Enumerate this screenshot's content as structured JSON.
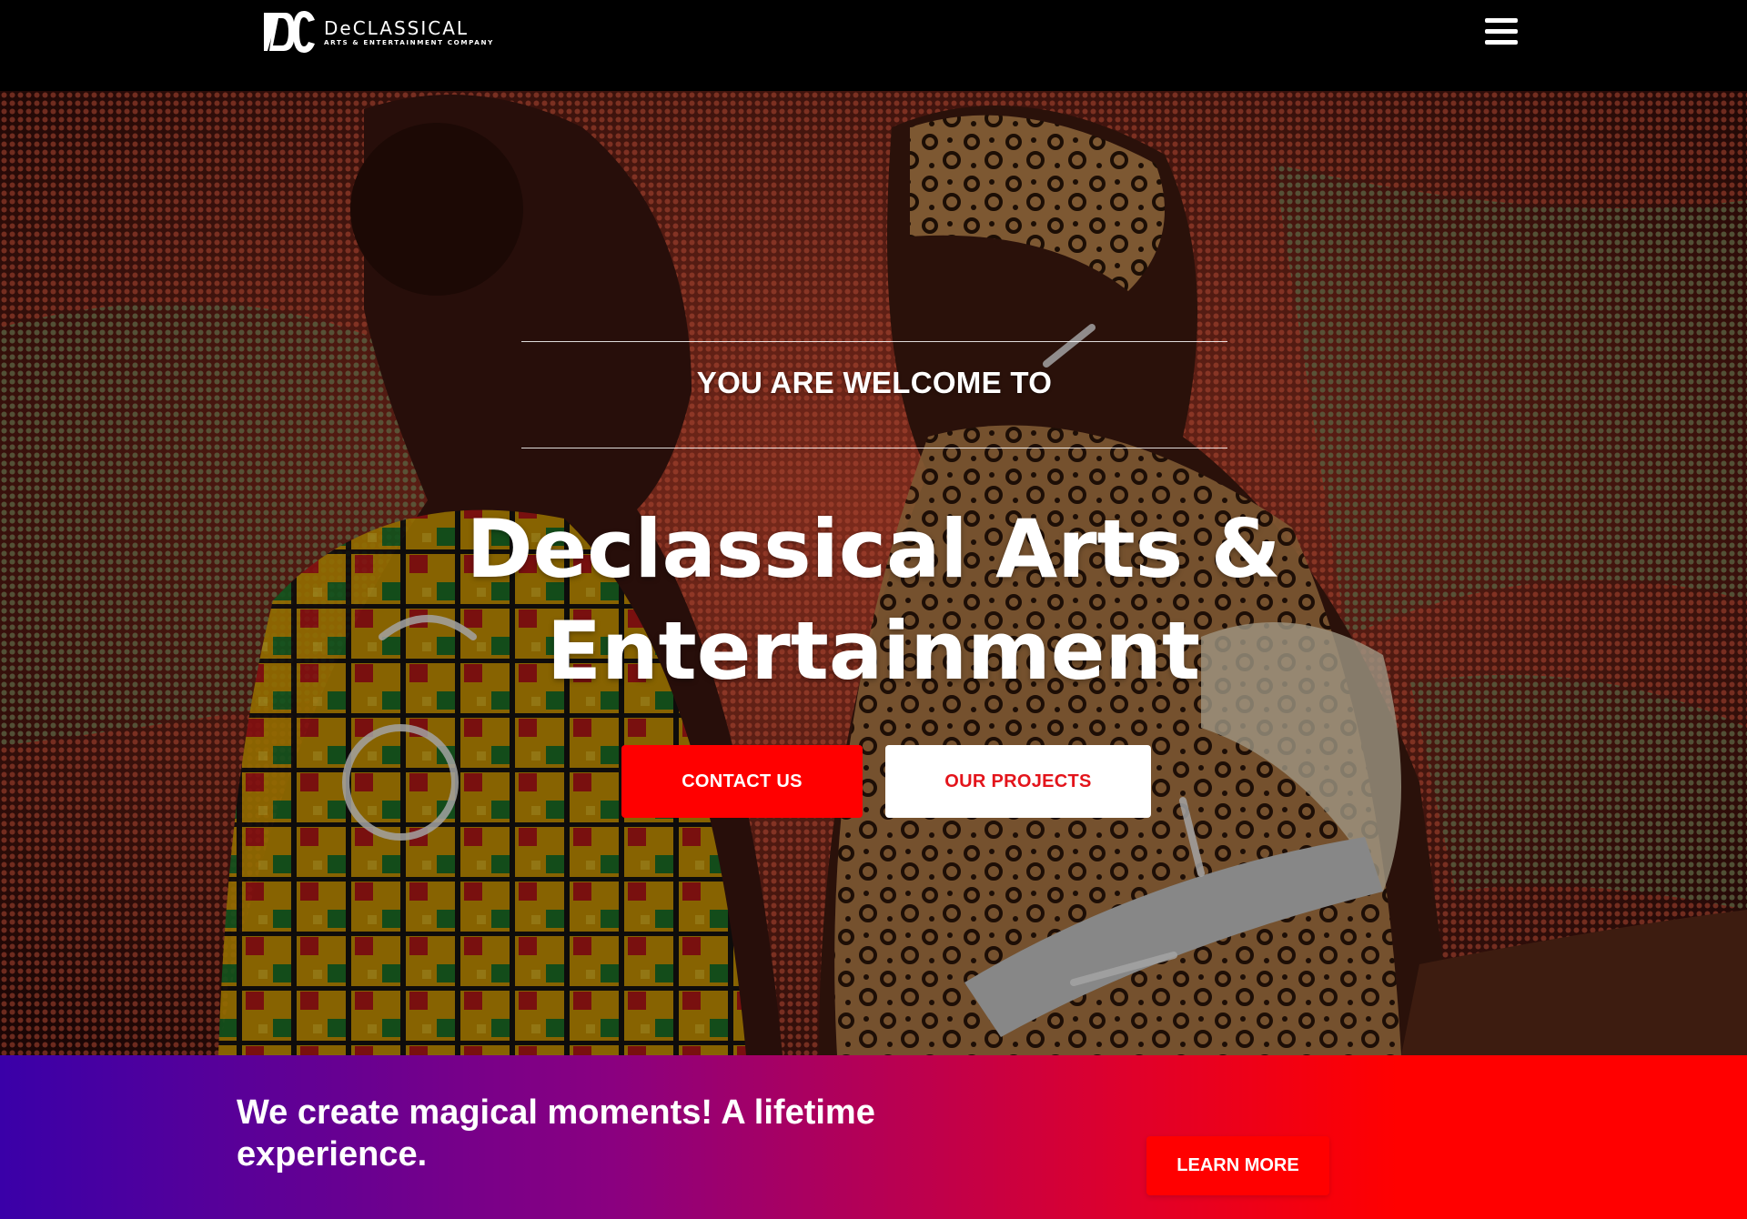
{
  "header": {
    "logo_name": "DeCLASSICAL",
    "logo_tagline": "ARTS & ENTERTAINMENT COMPANY",
    "menu_icon": "hamburger-menu-icon"
  },
  "hero": {
    "kicker": "YOU ARE WELCOME TO",
    "title_line1": "Declassical Arts &",
    "title_line2": "Entertainment",
    "contact_button": "CONTACT US",
    "projects_button": "OUR PROJECTS",
    "background": "stage-performers-photo"
  },
  "banner": {
    "text": "We create magical moments! A lifetime experience.",
    "button": "LEARN MORE"
  },
  "colors": {
    "accent_red": "#ff0000",
    "header_bg": "#000000",
    "gradient_start": "#3a00a8",
    "gradient_end": "#ff0000"
  }
}
